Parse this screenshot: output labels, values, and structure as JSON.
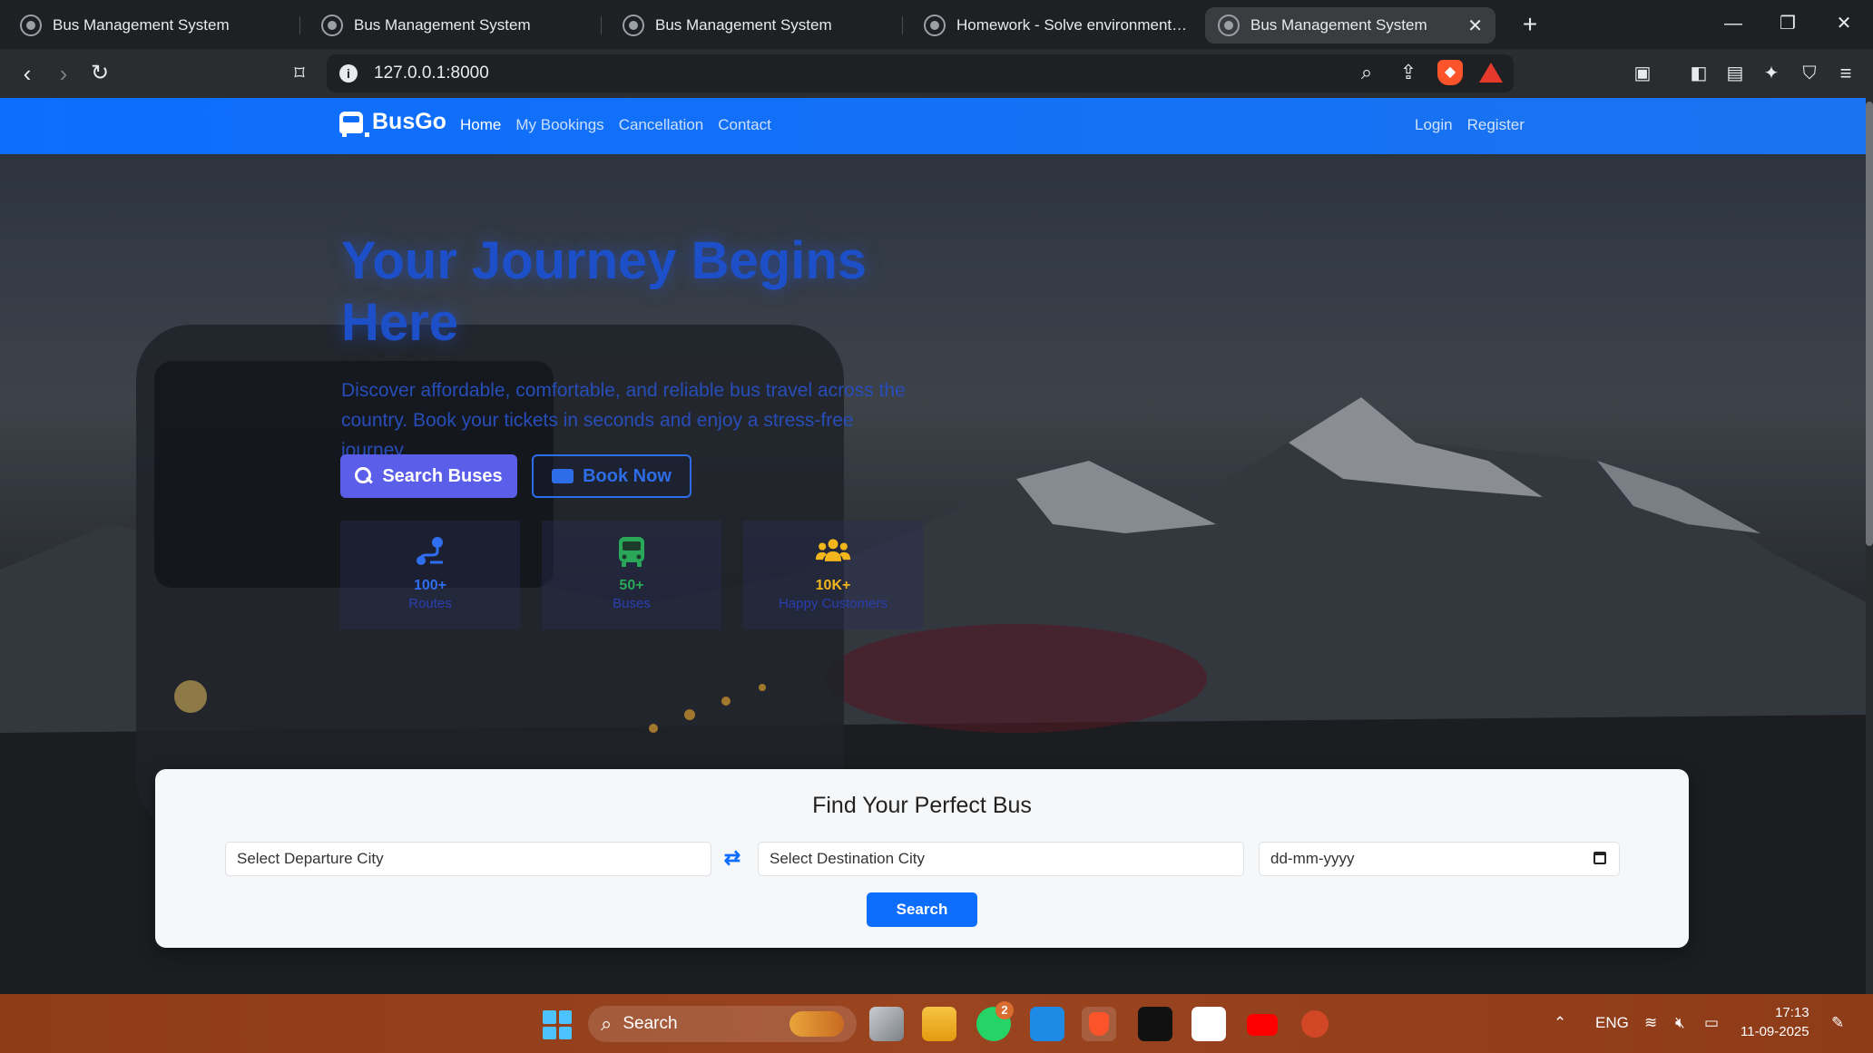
{
  "browser": {
    "tabs": [
      {
        "title": "Bus Management System",
        "active": false
      },
      {
        "title": "Bus Management System",
        "active": false
      },
      {
        "title": "Bus Management System",
        "active": false
      },
      {
        "title": "Homework - Solve environment error",
        "active": false
      },
      {
        "title": "Bus Management System",
        "active": true
      }
    ],
    "new_tab_icon": "plus-icon",
    "url": "127.0.0.1:8000"
  },
  "navbar": {
    "brand": "BusGo",
    "links": [
      "Home",
      "My Bookings",
      "Cancellation",
      "Contact"
    ],
    "active_link": "Home",
    "login": "Login",
    "register": "Register"
  },
  "hero": {
    "title": "Your Journey Begins Here",
    "subtitle": "Discover affordable, comfortable, and reliable bus travel across the country. Book your tickets in seconds and enjoy a stress-free journey.",
    "search_buses_label": "Search Buses",
    "book_now_label": "Book Now",
    "stats": [
      {
        "value": "100+",
        "label": "Routes",
        "icon": "route-icon",
        "color": "#2f6ef0"
      },
      {
        "value": "50+",
        "label": "Buses",
        "icon": "bus-icon",
        "color": "#2aa85a"
      },
      {
        "value": "10K+",
        "label": "Happy Customers",
        "icon": "users-icon",
        "color": "#f2b51b"
      }
    ]
  },
  "search_form": {
    "title": "Find Your Perfect Bus",
    "departure_placeholder": "Select Departure City",
    "destination_placeholder": "Select Destination City",
    "date_placeholder": "dd-mm-yyyy",
    "search_label": "Search"
  },
  "taskbar": {
    "search_label": "Search",
    "whatsapp_badge": "2",
    "language": "ENG",
    "time": "17:13",
    "date": "11-09-2025"
  },
  "colors": {
    "navbar": "#0d6efd",
    "accent_button": "#5a5ee8",
    "search_button": "#0d6efd",
    "taskbar": "#9a4420"
  }
}
